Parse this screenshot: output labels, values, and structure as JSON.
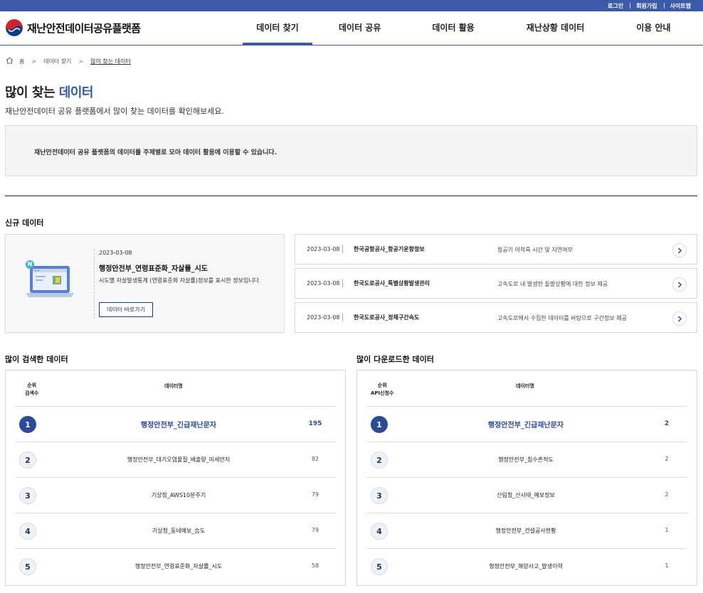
{
  "utility": [
    "로그인",
    "회원가입",
    "사이트맵"
  ],
  "brand": {
    "name": "재난안전데이터공유플랫폼"
  },
  "nav": [
    "데이터 찾기",
    "데이터 공유",
    "데이터 활용",
    "재난상황 데이터",
    "이용 안내"
  ],
  "breadcrumb": {
    "home": "홈",
    "level1": "데이터 찾기",
    "current": "많이 찾는 데이터"
  },
  "page": {
    "title_prefix": "많이 찾는",
    "title_highlight": "데이터",
    "description": "재난안전데이터 공유 플랫폼에서 많이 찾는 데이터를 확인해보세요.",
    "notice": "재난안전데이터 공유 플랫폼의 데이터를 주제별로 모아 데이터 활용에 이용할 수 있습니다."
  },
  "new_data": {
    "title": "신규 데이터",
    "badge": "N",
    "featured": {
      "date": "2023-03-08",
      "title": "행정안전부_연령표준화_자살률_시도",
      "description": "시도별 자살발생통계 (연령표준화 자살률)정보를 표시한 정보입니다",
      "button": "데이터 바로가기"
    },
    "items": [
      {
        "date": "2023-03-08",
        "title": "한국공항공사_항공기운항정보",
        "summary": "항공기 이착륙 시간 및 지연여부"
      },
      {
        "date": "2023-03-08",
        "title": "한국도로공사_특별상황발생관리",
        "summary": "고속도로 내 발생한 돌발상황에 대한 정보 제공"
      },
      {
        "date": "2023-03-08",
        "title": "한국도로공사_정체구간속도",
        "summary": "고속도로에서 수집한 데이터를 바탕으로 구간정보 제공"
      }
    ]
  },
  "searched": {
    "title": "많이 검색한 데이터",
    "col_rank": "순위",
    "col_metric": "검색수",
    "col_name": "데이터명",
    "rows": [
      {
        "rank": "1",
        "name": "행정안전부_긴급재난문자",
        "count": "195"
      },
      {
        "rank": "2",
        "name": "행정안전부_대기오염물질_배출량_미세먼지",
        "count": "82"
      },
      {
        "rank": "3",
        "name": "기상청_AWS10분주기",
        "count": "79"
      },
      {
        "rank": "4",
        "name": "기상청_동네예보_습도",
        "count": "79"
      },
      {
        "rank": "5",
        "name": "행정안전부_연령표준화_자살률_시도",
        "count": "58"
      }
    ]
  },
  "downloaded": {
    "title": "많이 다운로드한 데이터",
    "col_rank": "순위",
    "col_metric": "API신청수",
    "col_name": "데이터명",
    "rows": [
      {
        "rank": "1",
        "name": "행정안전부_긴급재난문자",
        "count": "2"
      },
      {
        "rank": "2",
        "name": "행정안전부_침수흔적도",
        "count": "2"
      },
      {
        "rank": "3",
        "name": "산림청_산사태_예보정보",
        "count": "2"
      },
      {
        "rank": "4",
        "name": "행정안전부_건설공사현황",
        "count": "1"
      },
      {
        "rank": "5",
        "name": "행정안전부_해양사고_발생이력",
        "count": "1"
      }
    ]
  },
  "colors": {
    "primary": "#3b5aa8",
    "rank_top": "#2b4a99",
    "highlight": "#2f58b5"
  },
  "icons": [
    "government-emblem-icon",
    "home-icon",
    "laptop-illustration-icon",
    "chevron-right-icon"
  ]
}
